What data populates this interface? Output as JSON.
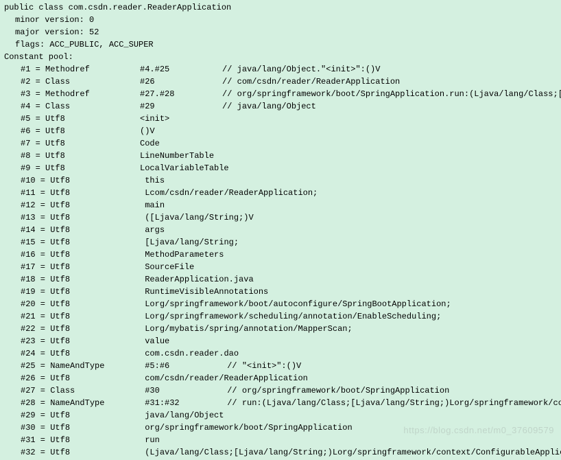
{
  "header": {
    "class_decl": "public class com.csdn.reader.ReaderApplication",
    "minor_version": "minor version: 0",
    "major_version": "major version: 52",
    "flags": "flags: ACC_PUBLIC, ACC_SUPER",
    "constant_pool": "Constant pool:"
  },
  "pool": [
    {
      "idx": " #1",
      "type": "Methodref",
      "val": "#4.#25",
      "comment": "// java/lang/Object.\"<init>\":()V"
    },
    {
      "idx": " #2",
      "type": "Class",
      "val": "#26",
      "comment": "// com/csdn/reader/ReaderApplication"
    },
    {
      "idx": " #3",
      "type": "Methodref",
      "val": "#27.#28",
      "comment": "// org/springframework/boot/SpringApplication.run:(Ljava/lang/Class;[Ljava/lang/String;)"
    },
    {
      "idx": " #4",
      "type": "Class",
      "val": "#29",
      "comment": "// java/lang/Object"
    },
    {
      "idx": " #5",
      "type": "Utf8",
      "val": "<init>",
      "comment": ""
    },
    {
      "idx": " #6",
      "type": "Utf8",
      "val": "()V",
      "comment": ""
    },
    {
      "idx": " #7",
      "type": "Utf8",
      "val": "Code",
      "comment": ""
    },
    {
      "idx": " #8",
      "type": "Utf8",
      "val": "LineNumberTable",
      "comment": ""
    },
    {
      "idx": " #9",
      "type": "Utf8",
      "val": "LocalVariableTable",
      "comment": ""
    },
    {
      "idx": "#10",
      "type": "Utf8",
      "val": "this",
      "comment": ""
    },
    {
      "idx": "#11",
      "type": "Utf8",
      "val": "Lcom/csdn/reader/ReaderApplication;",
      "comment": ""
    },
    {
      "idx": "#12",
      "type": "Utf8",
      "val": "main",
      "comment": ""
    },
    {
      "idx": "#13",
      "type": "Utf8",
      "val": "([Ljava/lang/String;)V",
      "comment": ""
    },
    {
      "idx": "#14",
      "type": "Utf8",
      "val": "args",
      "comment": ""
    },
    {
      "idx": "#15",
      "type": "Utf8",
      "val": "[Ljava/lang/String;",
      "comment": ""
    },
    {
      "idx": "#16",
      "type": "Utf8",
      "val": "MethodParameters",
      "comment": ""
    },
    {
      "idx": "#17",
      "type": "Utf8",
      "val": "SourceFile",
      "comment": ""
    },
    {
      "idx": "#18",
      "type": "Utf8",
      "val": "ReaderApplication.java",
      "comment": ""
    },
    {
      "idx": "#19",
      "type": "Utf8",
      "val": "RuntimeVisibleAnnotations",
      "comment": ""
    },
    {
      "idx": "#20",
      "type": "Utf8",
      "val": "Lorg/springframework/boot/autoconfigure/SpringBootApplication;",
      "comment": ""
    },
    {
      "idx": "#21",
      "type": "Utf8",
      "val": "Lorg/springframework/scheduling/annotation/EnableScheduling;",
      "comment": ""
    },
    {
      "idx": "#22",
      "type": "Utf8",
      "val": "Lorg/mybatis/spring/annotation/MapperScan;",
      "comment": ""
    },
    {
      "idx": "#23",
      "type": "Utf8",
      "val": "value",
      "comment": ""
    },
    {
      "idx": "#24",
      "type": "Utf8",
      "val": "com.csdn.reader.dao",
      "comment": ""
    },
    {
      "idx": "#25",
      "type": "NameAndType",
      "val": "#5:#6",
      "comment": "// \"<init>\":()V"
    },
    {
      "idx": "#26",
      "type": "Utf8",
      "val": "com/csdn/reader/ReaderApplication",
      "comment": ""
    },
    {
      "idx": "#27",
      "type": "Class",
      "val": "#30",
      "comment": "// org/springframework/boot/SpringApplication"
    },
    {
      "idx": "#28",
      "type": "NameAndType",
      "val": "#31:#32",
      "comment": "// run:(Ljava/lang/Class;[Ljava/lang/String;)Lorg/springframework/context/ConfigurableAp"
    },
    {
      "idx": "#29",
      "type": "Utf8",
      "val": "java/lang/Object",
      "comment": ""
    },
    {
      "idx": "#30",
      "type": "Utf8",
      "val": "org/springframework/boot/SpringApplication",
      "comment": ""
    },
    {
      "idx": "#31",
      "type": "Utf8",
      "val": "run",
      "comment": ""
    },
    {
      "idx": "#32",
      "type": "Utf8",
      "val": "(Ljava/lang/Class;[Ljava/lang/String;)Lorg/springframework/context/ConfigurableApplicationContext;",
      "comment": ""
    }
  ],
  "watermark": "https://blog.csdn.net/m0_37609579"
}
